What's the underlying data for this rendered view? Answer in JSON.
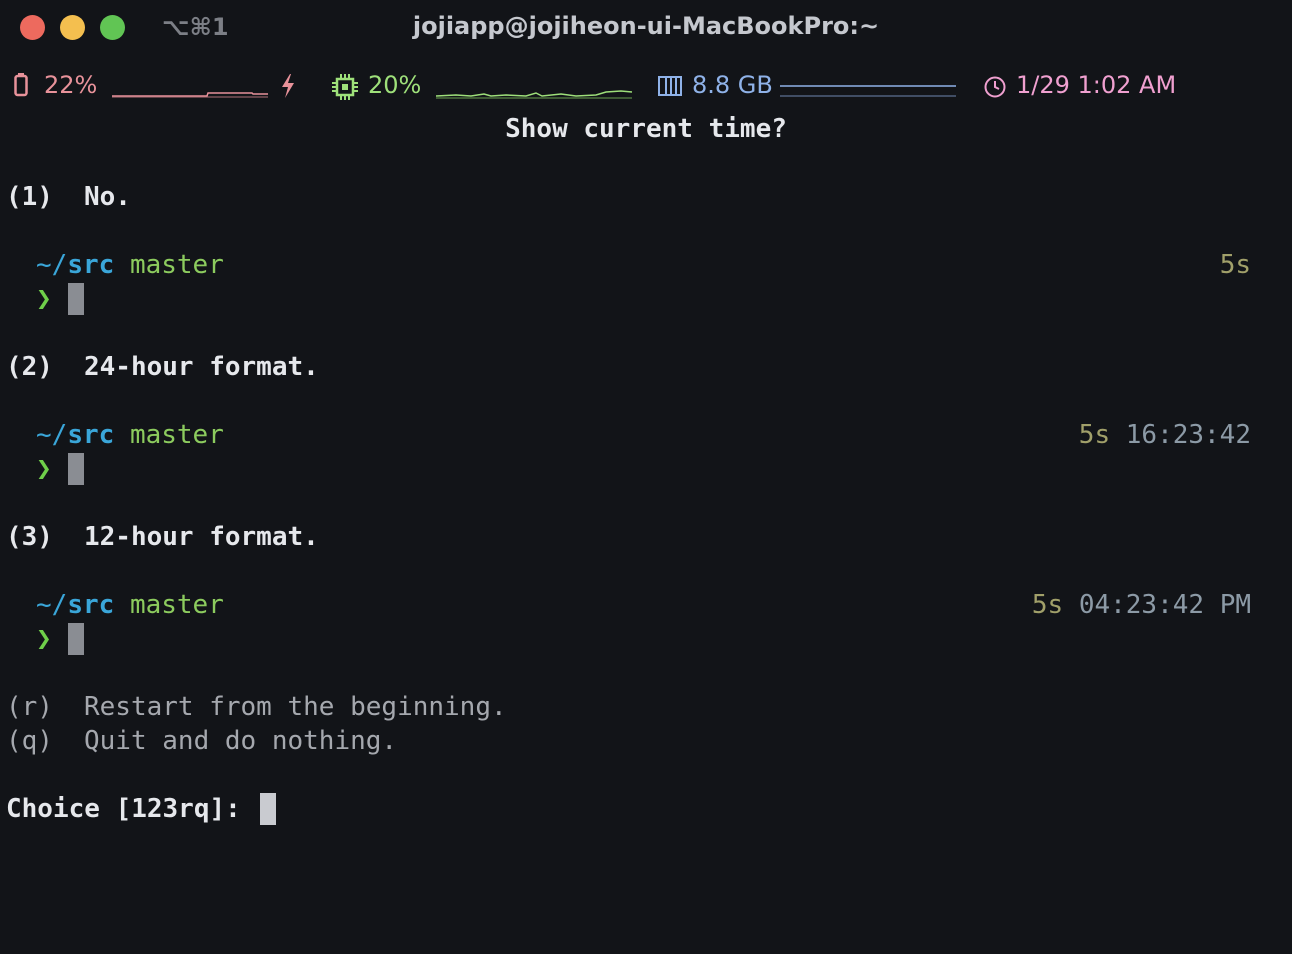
{
  "window": {
    "shortcut": "⌥⌘1",
    "title": "jojiapp@jojiheon-ui-MacBookPro:~"
  },
  "status_bar": {
    "battery": {
      "icon": "battery-icon",
      "value": "22%",
      "color": "#e8929a"
    },
    "charging": {
      "icon": "lightning-icon",
      "color": "#e8929a"
    },
    "cpu": {
      "icon": "cpu-chip-icon",
      "value": "20%",
      "color": "#9ee07a"
    },
    "memory": {
      "icon": "memory-icon",
      "value": "8.8 GB",
      "color": "#8fb2e8"
    },
    "clock": {
      "icon": "clock-icon",
      "value": "1/29 1:02 AM",
      "color": "#f0a0d0"
    }
  },
  "question": "Show current time?",
  "options": [
    {
      "key": "(1)",
      "label": "No.",
      "preview": {
        "path_tilde": "~/",
        "path_dir": "src",
        "branch": "master",
        "duration": "5s",
        "clock": "",
        "prompt": "❯"
      }
    },
    {
      "key": "(2)",
      "label": "24-hour format.",
      "preview": {
        "path_tilde": "~/",
        "path_dir": "src",
        "branch": "master",
        "duration": "5s",
        "clock": "16:23:42",
        "prompt": "❯"
      }
    },
    {
      "key": "(3)",
      "label": "12-hour format.",
      "preview": {
        "path_tilde": "~/",
        "path_dir": "src",
        "branch": "master",
        "duration": "5s",
        "clock": "04:23:42 PM",
        "prompt": "❯"
      }
    }
  ],
  "extra_options": [
    {
      "key": "(r)",
      "label": "Restart from the beginning."
    },
    {
      "key": "(q)",
      "label": "Quit and do nothing."
    }
  ],
  "choice_prompt": "Choice [123rq]: "
}
